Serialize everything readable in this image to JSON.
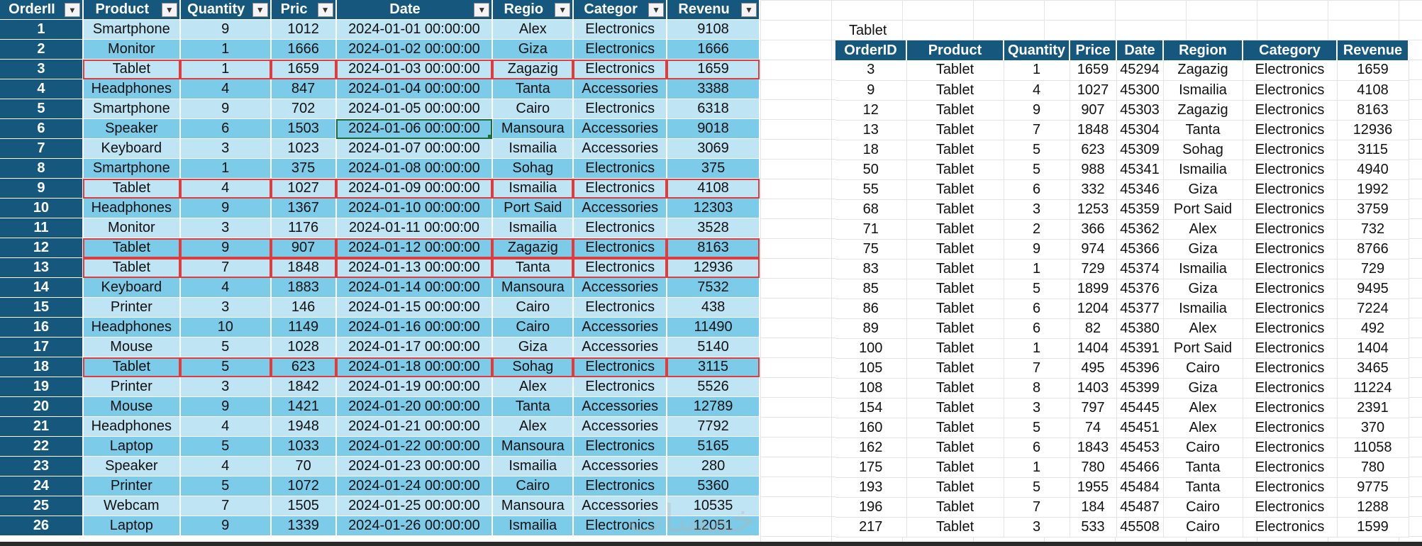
{
  "main": {
    "headers": [
      "OrderII",
      "Product",
      "Quantity",
      "Pric",
      "Date",
      "Regio",
      "Categor",
      "Revenu"
    ],
    "filter_icons": [
      "sort-filter-icon",
      "filter-dropdown-icon",
      "filter-dropdown-icon",
      "filter-dropdown-icon",
      "filter-dropdown-icon",
      "filter-dropdown-icon",
      "filter-dropdown-icon",
      "filter-dropdown-icon"
    ],
    "highlighted_ids": [
      3,
      9,
      12,
      13,
      18
    ],
    "selected_cell": {
      "row": 6,
      "col": 4
    },
    "rows": [
      [
        "1",
        "Smartphone",
        "9",
        "1012",
        "2024-01-01 00:00:00",
        "Alex",
        "Electronics",
        "9108"
      ],
      [
        "2",
        "Monitor",
        "1",
        "1666",
        "2024-01-02 00:00:00",
        "Giza",
        "Electronics",
        "1666"
      ],
      [
        "3",
        "Tablet",
        "1",
        "1659",
        "2024-01-03 00:00:00",
        "Zagazig",
        "Electronics",
        "1659"
      ],
      [
        "4",
        "Headphones",
        "4",
        "847",
        "2024-01-04 00:00:00",
        "Tanta",
        "Accessories",
        "3388"
      ],
      [
        "5",
        "Smartphone",
        "9",
        "702",
        "2024-01-05 00:00:00",
        "Cairo",
        "Electronics",
        "6318"
      ],
      [
        "6",
        "Speaker",
        "6",
        "1503",
        "2024-01-06 00:00:00",
        "Mansoura",
        "Accessories",
        "9018"
      ],
      [
        "7",
        "Keyboard",
        "3",
        "1023",
        "2024-01-07 00:00:00",
        "Ismailia",
        "Accessories",
        "3069"
      ],
      [
        "8",
        "Smartphone",
        "1",
        "375",
        "2024-01-08 00:00:00",
        "Sohag",
        "Electronics",
        "375"
      ],
      [
        "9",
        "Tablet",
        "4",
        "1027",
        "2024-01-09 00:00:00",
        "Ismailia",
        "Electronics",
        "4108"
      ],
      [
        "10",
        "Headphones",
        "9",
        "1367",
        "2024-01-10 00:00:00",
        "Port Said",
        "Accessories",
        "12303"
      ],
      [
        "11",
        "Monitor",
        "3",
        "1176",
        "2024-01-11 00:00:00",
        "Ismailia",
        "Electronics",
        "3528"
      ],
      [
        "12",
        "Tablet",
        "9",
        "907",
        "2024-01-12 00:00:00",
        "Zagazig",
        "Electronics",
        "8163"
      ],
      [
        "13",
        "Tablet",
        "7",
        "1848",
        "2024-01-13 00:00:00",
        "Tanta",
        "Electronics",
        "12936"
      ],
      [
        "14",
        "Keyboard",
        "4",
        "1883",
        "2024-01-14 00:00:00",
        "Mansoura",
        "Accessories",
        "7532"
      ],
      [
        "15",
        "Printer",
        "3",
        "146",
        "2024-01-15 00:00:00",
        "Cairo",
        "Electronics",
        "438"
      ],
      [
        "16",
        "Headphones",
        "10",
        "1149",
        "2024-01-16 00:00:00",
        "Cairo",
        "Accessories",
        "11490"
      ],
      [
        "17",
        "Mouse",
        "5",
        "1028",
        "2024-01-17 00:00:00",
        "Giza",
        "Accessories",
        "5140"
      ],
      [
        "18",
        "Tablet",
        "5",
        "623",
        "2024-01-18 00:00:00",
        "Sohag",
        "Electronics",
        "3115"
      ],
      [
        "19",
        "Printer",
        "3",
        "1842",
        "2024-01-19 00:00:00",
        "Alex",
        "Electronics",
        "5526"
      ],
      [
        "20",
        "Mouse",
        "9",
        "1421",
        "2024-01-20 00:00:00",
        "Tanta",
        "Accessories",
        "12789"
      ],
      [
        "21",
        "Headphones",
        "4",
        "1948",
        "2024-01-21 00:00:00",
        "Alex",
        "Accessories",
        "7792"
      ],
      [
        "22",
        "Laptop",
        "5",
        "1033",
        "2024-01-22 00:00:00",
        "Mansoura",
        "Electronics",
        "5165"
      ],
      [
        "23",
        "Speaker",
        "4",
        "70",
        "2024-01-23 00:00:00",
        "Ismailia",
        "Accessories",
        "280"
      ],
      [
        "24",
        "Printer",
        "5",
        "1072",
        "2024-01-24 00:00:00",
        "Cairo",
        "Electronics",
        "5360"
      ],
      [
        "25",
        "Webcam",
        "7",
        "1505",
        "2024-01-25 00:00:00",
        "Mansoura",
        "Accessories",
        "10535"
      ],
      [
        "26",
        "Laptop",
        "9",
        "1339",
        "2024-01-26 00:00:00",
        "Ismailia",
        "Electronics",
        "12051"
      ]
    ]
  },
  "result": {
    "criteria_label": "Tablet",
    "headers": [
      "OrderID",
      "Product",
      "Quantity",
      "Price",
      "Date",
      "Region",
      "Category",
      "Revenue"
    ],
    "rows": [
      [
        "3",
        "Tablet",
        "1",
        "1659",
        "45294",
        "Zagazig",
        "Electronics",
        "1659"
      ],
      [
        "9",
        "Tablet",
        "4",
        "1027",
        "45300",
        "Ismailia",
        "Electronics",
        "4108"
      ],
      [
        "12",
        "Tablet",
        "9",
        "907",
        "45303",
        "Zagazig",
        "Electronics",
        "8163"
      ],
      [
        "13",
        "Tablet",
        "7",
        "1848",
        "45304",
        "Tanta",
        "Electronics",
        "12936"
      ],
      [
        "18",
        "Tablet",
        "5",
        "623",
        "45309",
        "Sohag",
        "Electronics",
        "3115"
      ],
      [
        "50",
        "Tablet",
        "5",
        "988",
        "45341",
        "Ismailia",
        "Electronics",
        "4940"
      ],
      [
        "55",
        "Tablet",
        "6",
        "332",
        "45346",
        "Giza",
        "Electronics",
        "1992"
      ],
      [
        "68",
        "Tablet",
        "3",
        "1253",
        "45359",
        "Port Said",
        "Electronics",
        "3759"
      ],
      [
        "71",
        "Tablet",
        "2",
        "366",
        "45362",
        "Alex",
        "Electronics",
        "732"
      ],
      [
        "75",
        "Tablet",
        "9",
        "974",
        "45366",
        "Giza",
        "Electronics",
        "8766"
      ],
      [
        "83",
        "Tablet",
        "1",
        "729",
        "45374",
        "Ismailia",
        "Electronics",
        "729"
      ],
      [
        "85",
        "Tablet",
        "5",
        "1899",
        "45376",
        "Giza",
        "Electronics",
        "9495"
      ],
      [
        "86",
        "Tablet",
        "6",
        "1204",
        "45377",
        "Ismailia",
        "Electronics",
        "7224"
      ],
      [
        "89",
        "Tablet",
        "6",
        "82",
        "45380",
        "Alex",
        "Electronics",
        "492"
      ],
      [
        "100",
        "Tablet",
        "1",
        "1404",
        "45391",
        "Port Said",
        "Electronics",
        "1404"
      ],
      [
        "105",
        "Tablet",
        "7",
        "495",
        "45396",
        "Cairo",
        "Electronics",
        "3465"
      ],
      [
        "108",
        "Tablet",
        "8",
        "1403",
        "45399",
        "Giza",
        "Electronics",
        "11224"
      ],
      [
        "154",
        "Tablet",
        "3",
        "797",
        "45445",
        "Alex",
        "Electronics",
        "2391"
      ],
      [
        "160",
        "Tablet",
        "5",
        "74",
        "45451",
        "Alex",
        "Electronics",
        "370"
      ],
      [
        "162",
        "Tablet",
        "6",
        "1843",
        "45453",
        "Cairo",
        "Electronics",
        "11058"
      ],
      [
        "175",
        "Tablet",
        "1",
        "780",
        "45466",
        "Tanta",
        "Electronics",
        "780"
      ],
      [
        "193",
        "Tablet",
        "5",
        "1955",
        "45484",
        "Tanta",
        "Electronics",
        "9775"
      ],
      [
        "196",
        "Tablet",
        "7",
        "184",
        "45487",
        "Cairo",
        "Electronics",
        "1288"
      ],
      [
        "217",
        "Tablet",
        "3",
        "533",
        "45508",
        "Cairo",
        "Electronics",
        "1599"
      ]
    ]
  },
  "colors": {
    "header_bg": "#16577d",
    "band_light": "#bfe4f4",
    "band_dark": "#7ccbe9",
    "highlight_border": "#e23b3b",
    "selection_border": "#1f6b3a"
  }
}
